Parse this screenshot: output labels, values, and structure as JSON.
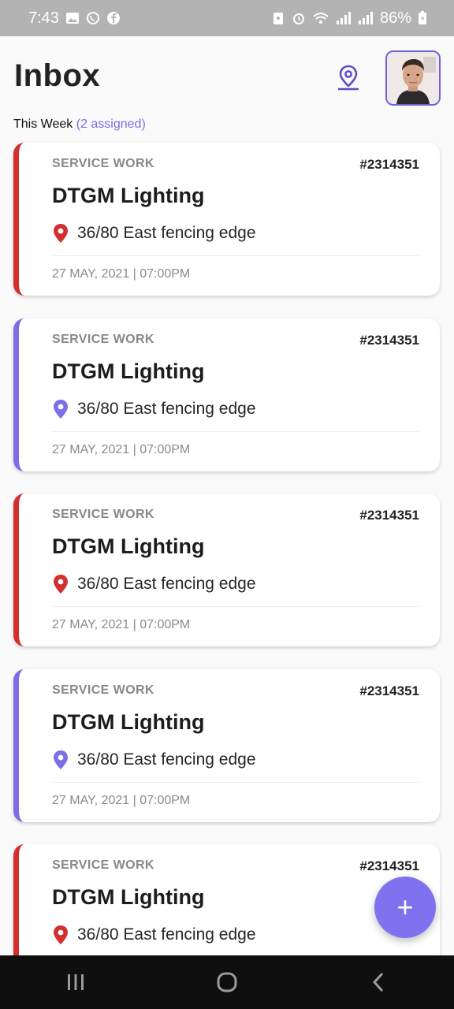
{
  "status_bar": {
    "time": "7:43",
    "battery": "86%"
  },
  "header": {
    "title": "Inbox"
  },
  "section": {
    "label": "This Week",
    "count": "(2 assigned)"
  },
  "cards": [
    {
      "category": "SERVICE WORK",
      "number": "#2314351",
      "name": "DTGM Lighting",
      "location": "36/80 East fencing edge",
      "datetime": "27 MAY, 2021  |  07:00PM",
      "accent": "#d32f2f"
    },
    {
      "category": "SERVICE WORK",
      "number": "#2314351",
      "name": "DTGM Lighting",
      "location": "36/80 East fencing edge",
      "datetime": "27 MAY, 2021  |  07:00PM",
      "accent": "#7b6ee6"
    },
    {
      "category": "SERVICE WORK",
      "number": "#2314351",
      "name": "DTGM Lighting",
      "location": "36/80 East fencing edge",
      "datetime": "27 MAY, 2021  |  07:00PM",
      "accent": "#d32f2f"
    },
    {
      "category": "SERVICE WORK",
      "number": "#2314351",
      "name": "DTGM Lighting",
      "location": "36/80 East fencing edge",
      "datetime": "27 MAY, 2021  |  07:00PM",
      "accent": "#7b6ee6"
    },
    {
      "category": "SERVICE WORK",
      "number": "#2314351",
      "name": "DTGM Lighting",
      "location": "36/80 East fencing edge",
      "datetime": "",
      "accent": "#d32f2f"
    }
  ],
  "fab": {
    "label": "+"
  },
  "colors": {
    "red": "#d32f2f",
    "purple": "#7b6ee6",
    "fab": "#7f72ee"
  },
  "icons": [
    "map-pin-outline-icon",
    "location-pin-icon",
    "plus-icon",
    "recents-icon",
    "home-icon",
    "back-icon"
  ]
}
